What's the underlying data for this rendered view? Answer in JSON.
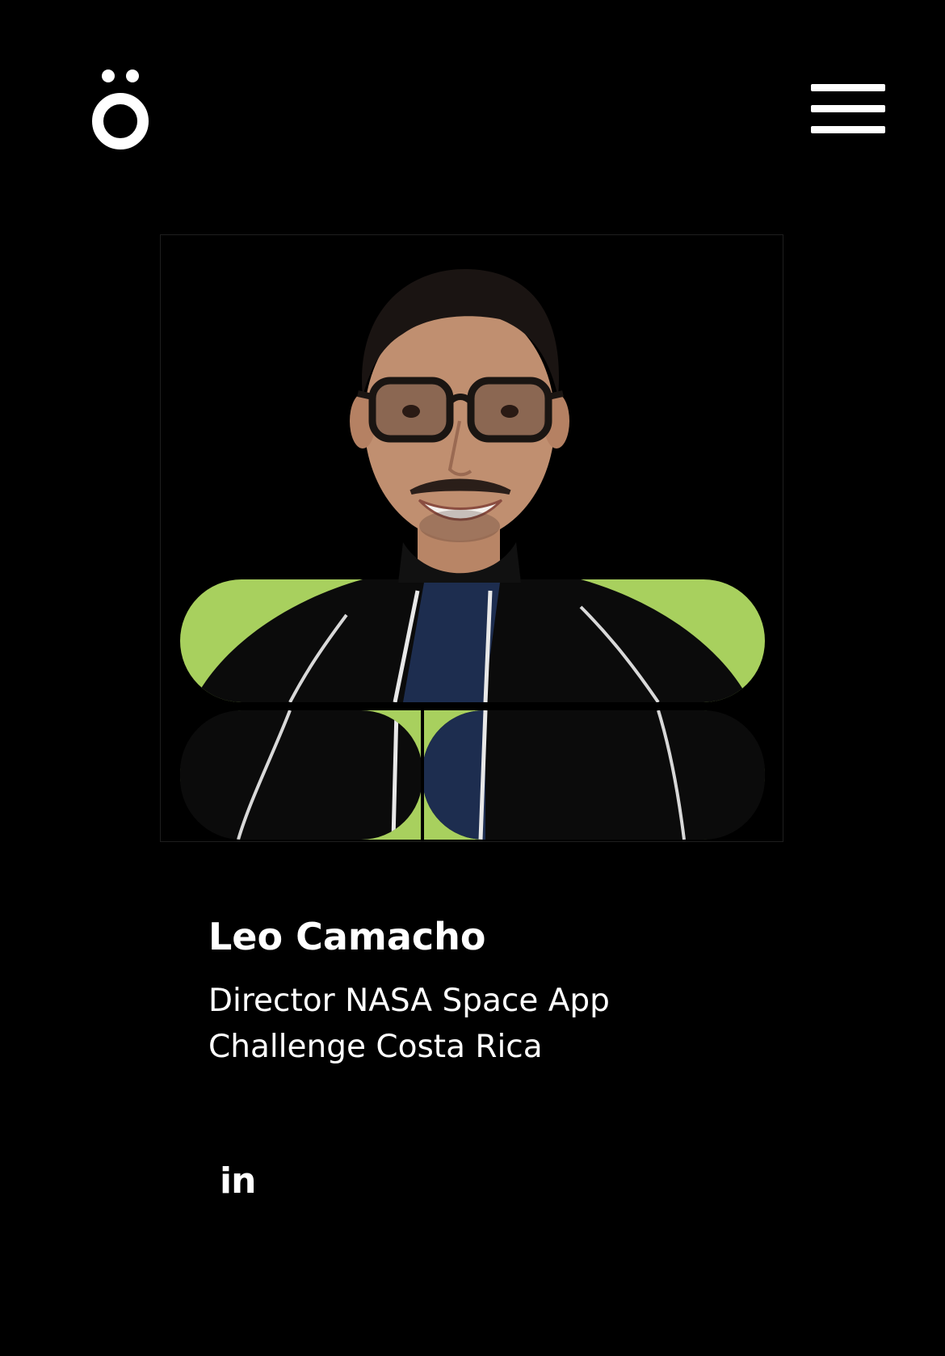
{
  "header": {
    "logo_icon": "o-umlaut-logo",
    "menu_icon": "hamburger-menu-icon"
  },
  "profile": {
    "photo_subject": "portrait-photo",
    "accent_color": "#a8d05e",
    "name": "Leo Camacho",
    "role": "Director NASA Space App Challenge Costa Rica",
    "social": {
      "linkedin_label": "in",
      "linkedin_icon": "linkedin-icon"
    }
  }
}
